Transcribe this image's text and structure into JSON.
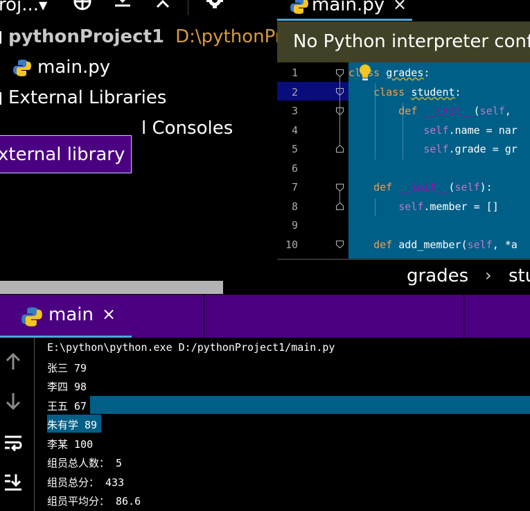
{
  "project_toolbar": {
    "project_label": "roj...",
    "icons": [
      "dropdown-icon",
      "crosshair-icon",
      "expand-all-icon",
      "collapse-all-icon",
      "gear-icon",
      "minimize-icon"
    ]
  },
  "project_tree": {
    "root": {
      "name": "pythonProject1",
      "path": "D:\\pythonPr"
    },
    "items": [
      {
        "label": "main.py",
        "icon": "python-file-icon"
      },
      {
        "label": "External Libraries"
      },
      {
        "label": "l Consoles"
      }
    ],
    "tooltip": "xternal library"
  },
  "editor": {
    "tab": {
      "label": "main.py",
      "close": "×"
    },
    "banner": "No Python interpreter conf",
    "lines": [
      {
        "no": "1",
        "text": "class grades:"
      },
      {
        "no": "2",
        "text": "    class student:"
      },
      {
        "no": "3",
        "text": "        def __init__(self,"
      },
      {
        "no": "4",
        "text": "            self.name = nar"
      },
      {
        "no": "5",
        "text": "            self.grade = gr"
      },
      {
        "no": "6",
        "text": ""
      },
      {
        "no": "7",
        "text": "    def __init__(self):"
      },
      {
        "no": "8",
        "text": "        self.member = []"
      },
      {
        "no": "9",
        "text": ""
      },
      {
        "no": "10",
        "text": "    def add_member(self, *a"
      }
    ],
    "breadcrumb": {
      "first": "grades",
      "separator": "›",
      "second": "stu"
    }
  },
  "run_panel": {
    "tab": {
      "label": "main",
      "close": "×"
    },
    "side_icons": [
      "up-arrow-icon",
      "down-arrow-icon",
      "soft-wrap-icon",
      "scroll-to-end-icon"
    ],
    "output": [
      "E:\\python\\python.exe D:/pythonProject1/main.py",
      "张三 79",
      "李四 98",
      "王五 67",
      "朱有学 89",
      "李某 100",
      "组员总人数： 5",
      "组员总分： 433",
      "组员平均分： 86.6"
    ]
  },
  "colors": {
    "code_bg": "#005f87",
    "banner_bg": "#414127",
    "run_tabbar_bg": "#4a0080",
    "tab_underline": "#4ea6dc",
    "path_color": "#d99a3a",
    "current_line_gutter": "#090c7a"
  }
}
